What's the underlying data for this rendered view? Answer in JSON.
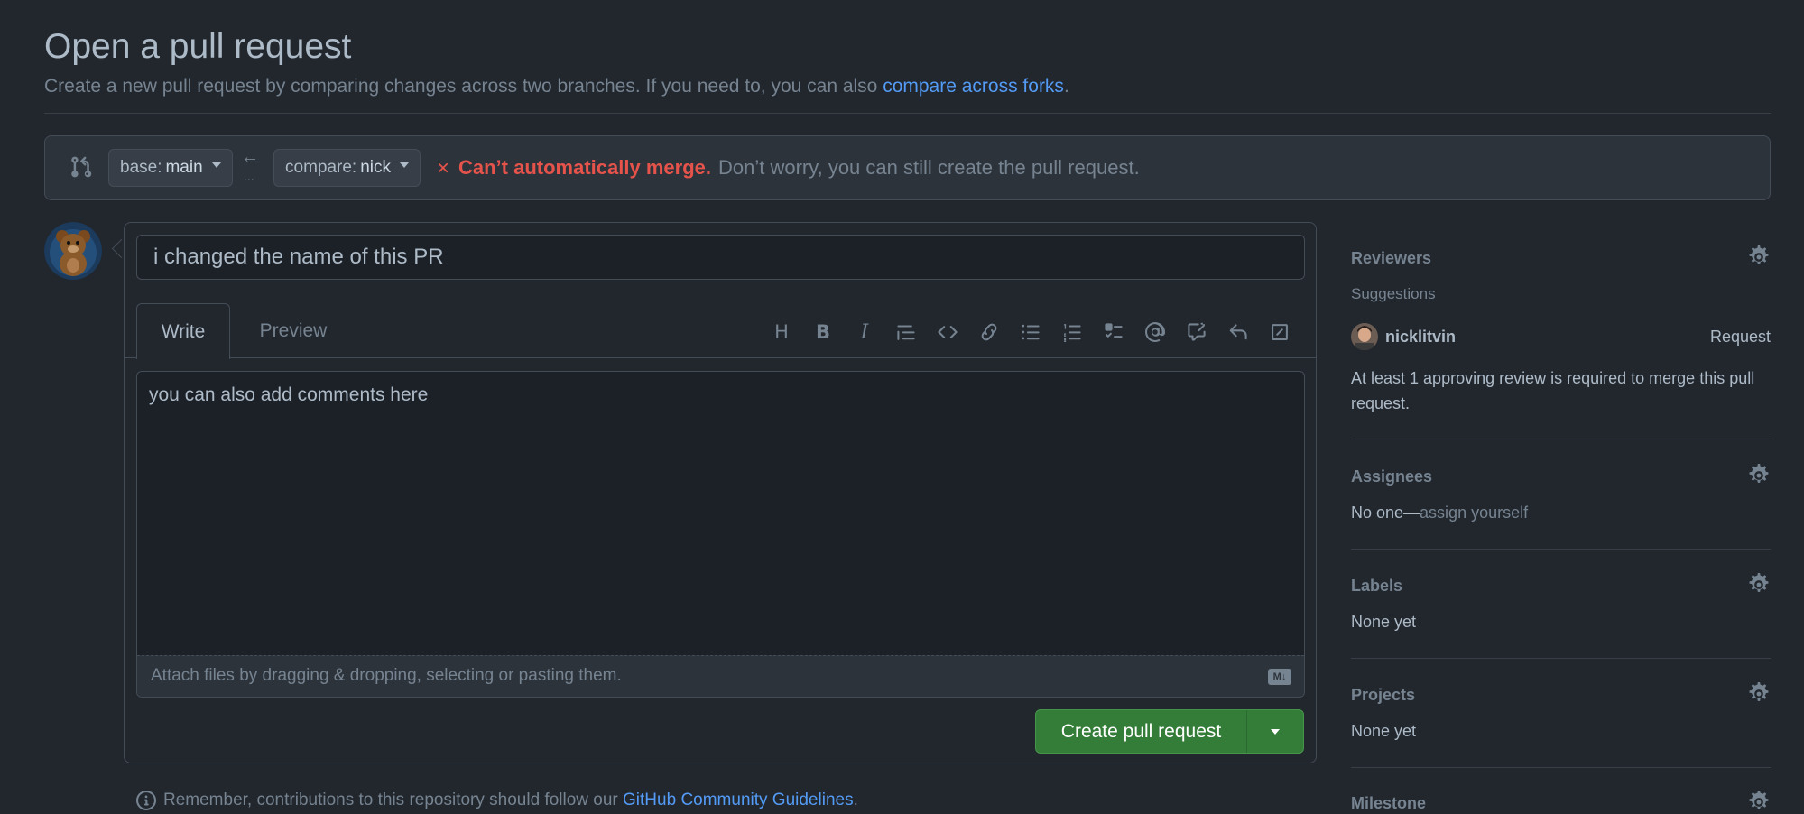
{
  "header": {
    "title": "Open a pull request",
    "subtitle_prefix": "Create a new pull request by comparing changes across two branches. If you need to, you can also ",
    "subtitle_link": "compare across forks",
    "subtitle_suffix": "."
  },
  "compare": {
    "base_label": "base:",
    "base_value": "main",
    "compare_label": "compare:",
    "compare_value": "nick",
    "arrow": "←",
    "dots": "...",
    "merge_status": "Can’t automatically merge.",
    "merge_note": "Don’t worry, you can still create the pull request."
  },
  "form": {
    "title_value": "i changed the name of this PR",
    "tab_write": "Write",
    "tab_preview": "Preview",
    "body_text": "you can also add comments here",
    "attach_text": "Attach files by dragging & dropping, selecting or pasting them.",
    "md_badge": "M↓",
    "create_button": "Create pull request"
  },
  "toolbar": {
    "heading": "H",
    "bold": "B",
    "italic": "I"
  },
  "footer": {
    "prefix": "Remember, contributions to this repository should follow our ",
    "link": "GitHub Community Guidelines",
    "suffix": "."
  },
  "sidebar": {
    "reviewers": {
      "title": "Reviewers",
      "suggestions": "Suggestions",
      "suggested_user": "nicklitvin",
      "request": "Request",
      "note": "At least 1 approving review is required to merge this pull request."
    },
    "assignees": {
      "title": "Assignees",
      "value_prefix": "No one—",
      "value_link": "assign yourself"
    },
    "labels": {
      "title": "Labels",
      "value": "None yet"
    },
    "projects": {
      "title": "Projects",
      "value": "None yet"
    },
    "milestone": {
      "title": "Milestone"
    }
  },
  "colors": {
    "background": "#22272e",
    "accent_link": "#539bf5",
    "danger": "#e5534b",
    "primary_button": "#347d39"
  }
}
